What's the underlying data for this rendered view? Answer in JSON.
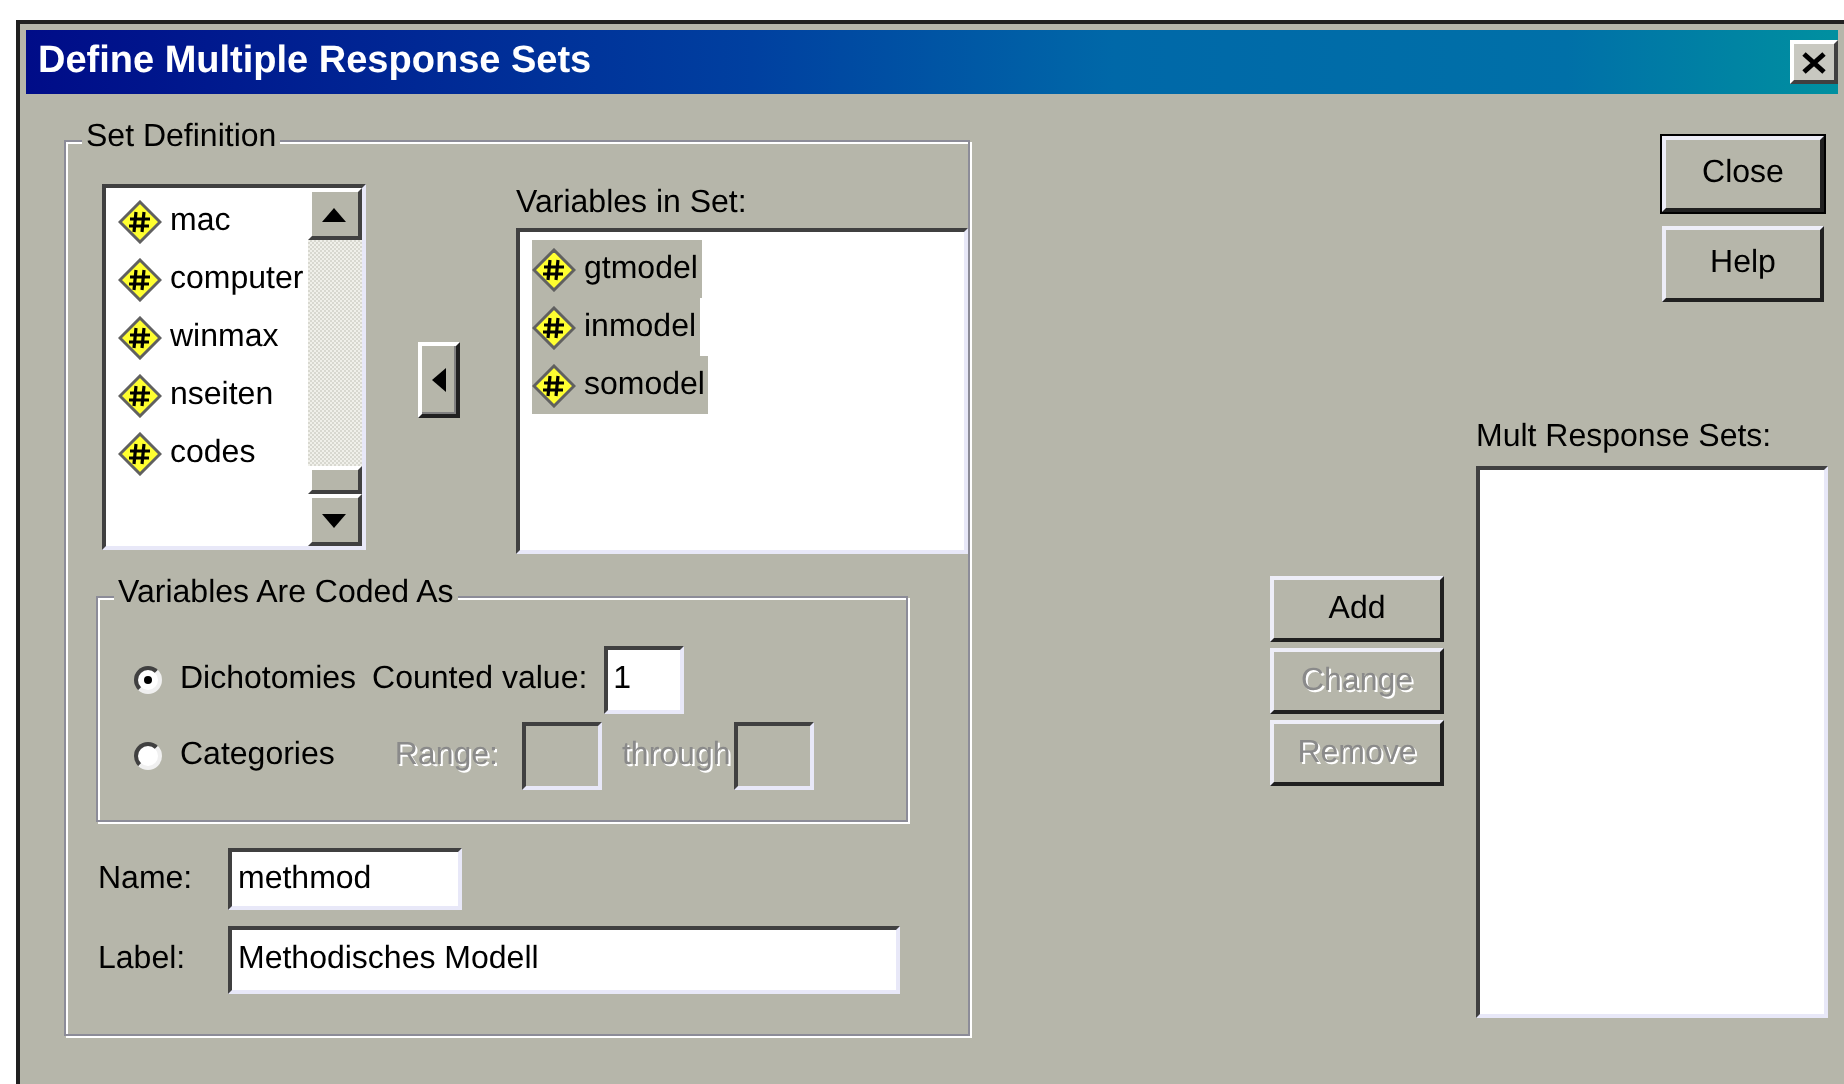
{
  "window": {
    "title": "Define Multiple Response Sets"
  },
  "set_definition": {
    "title": "Set Definition",
    "source_variables": [
      {
        "name": "mac",
        "selected": false
      },
      {
        "name": "computer",
        "selected": false
      },
      {
        "name": "winmax",
        "selected": false
      },
      {
        "name": "nseiten",
        "selected": false
      },
      {
        "name": "codes",
        "selected": false
      }
    ],
    "variables_in_set": {
      "label": "Variables in Set:",
      "items": [
        {
          "name": "gtmodel",
          "selected": true
        },
        {
          "name": "inmodel",
          "selected": true
        },
        {
          "name": "somodel",
          "selected": true
        }
      ]
    },
    "coded_as": {
      "title": "Variables Are Coded As",
      "options": [
        {
          "label": "Dichotomies",
          "selected": true
        },
        {
          "label": "Categories",
          "selected": false
        }
      ],
      "counted_value": {
        "label": "Counted value:",
        "value": "1"
      },
      "range": {
        "label": "Range:",
        "through_label": "through",
        "disabled": true
      }
    },
    "name_field": {
      "label": "Name:",
      "value": "methmod"
    },
    "label_field": {
      "label": "Label:",
      "value": "Methodisches Modell"
    }
  },
  "set_buttons": [
    {
      "label": "Add",
      "disabled": false
    },
    {
      "label": "Change",
      "disabled": true
    },
    {
      "label": "Remove",
      "disabled": true
    }
  ],
  "mult_response_sets": {
    "label": "Mult Response Sets:"
  },
  "dialog_buttons": [
    {
      "label": "Close",
      "default": true
    },
    {
      "label": "Help",
      "default": false
    }
  ]
}
